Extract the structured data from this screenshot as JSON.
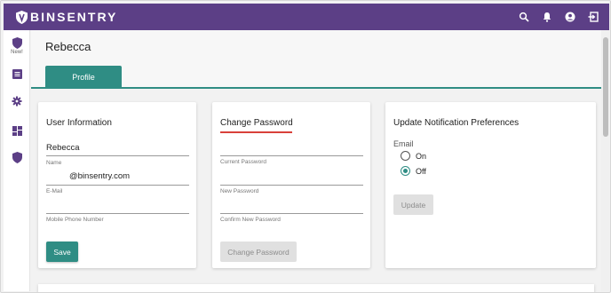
{
  "brand": {
    "name": "BINSENTRY",
    "logo_icon": "shield-logo-icon"
  },
  "topbar": {
    "icons": [
      "search-icon",
      "bell-icon",
      "account-icon",
      "logout-icon"
    ],
    "color": "#5c3f86"
  },
  "sidebar": {
    "items": [
      {
        "icon": "binsentry-icon",
        "badge": "New!"
      },
      {
        "icon": "list-icon"
      },
      {
        "icon": "gear-icon"
      },
      {
        "icon": "dashboard-icon"
      },
      {
        "icon": "binsentry-icon"
      }
    ]
  },
  "page": {
    "title": "Rebecca",
    "tab_label": "Profile",
    "accent": "#2f8d84"
  },
  "user_info": {
    "title": "User Information",
    "name_value": "Rebecca",
    "name_label": "Name",
    "email_value": "@binsentry.com",
    "email_label": "E-Mail",
    "phone_value": "",
    "phone_label": "Mobile Phone Number",
    "save_label": "Save"
  },
  "change_password": {
    "title": "Change Password",
    "current_label": "Current Password",
    "new_label": "New Password",
    "confirm_label": "Confirm New Password",
    "button_label": "Change Password",
    "underline_color": "#d9413a"
  },
  "notifications": {
    "title": "Update Notification Preferences",
    "group_label": "Email",
    "options": [
      {
        "label": "On",
        "checked": false
      },
      {
        "label": "Off",
        "checked": true
      }
    ],
    "button_label": "Update"
  }
}
